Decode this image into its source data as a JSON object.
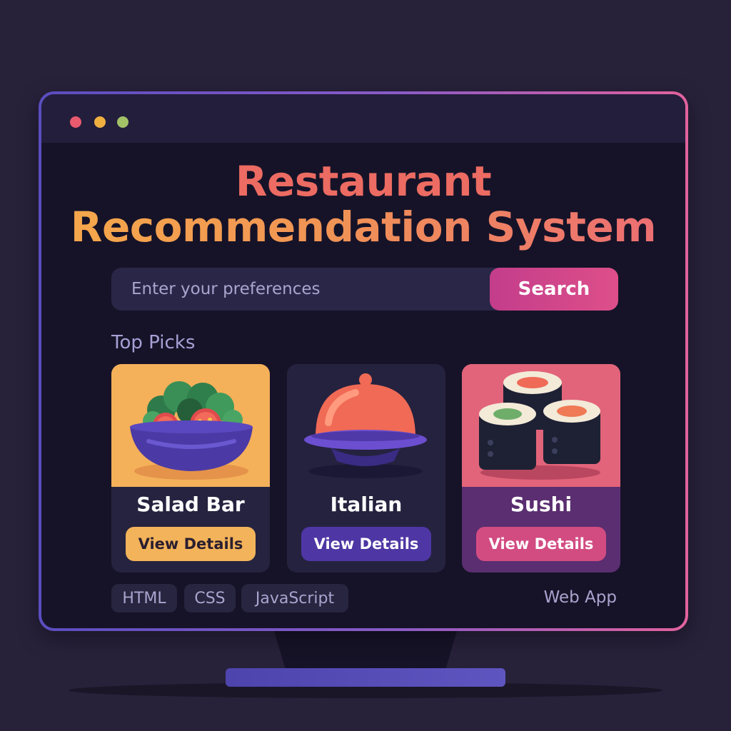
{
  "window": {
    "controls": [
      "close",
      "minimize",
      "maximize"
    ]
  },
  "hero": {
    "line1": "Restaurant",
    "line2": "Recommendation System"
  },
  "search": {
    "placeholder": "Enter your preferences",
    "button_label": "Search"
  },
  "top_picks": {
    "title": "Top Picks",
    "cards": [
      {
        "name": "Salad Bar",
        "button_label": "View Details",
        "icon": "salad-bowl-icon"
      },
      {
        "name": "Italian",
        "button_label": "View Details",
        "icon": "cloche-icon"
      },
      {
        "name": "Sushi",
        "button_label": "View Details",
        "icon": "sushi-icon"
      }
    ]
  },
  "tags": [
    "HTML",
    "CSS",
    "JavaScript"
  ],
  "footer_label": "Web App",
  "colors": {
    "background": "#27213a",
    "panel": "#161328",
    "accent_pink": "#d24c82",
    "accent_orange": "#f3b35a",
    "accent_purple": "#4e36a4"
  }
}
